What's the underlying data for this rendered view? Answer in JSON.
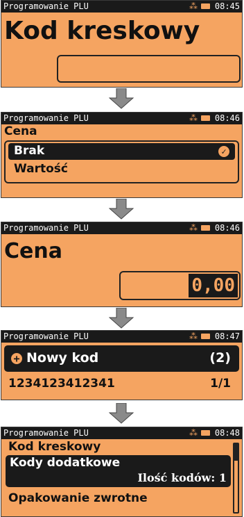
{
  "screen1": {
    "status_title": "Programowanie PLU",
    "time": "08:45",
    "heading": "Kod kreskowy",
    "input_value": ""
  },
  "screen2": {
    "status_title": "Programowanie PLU",
    "time": "08:46",
    "heading": "Cena",
    "options": [
      {
        "label": "Brak",
        "selected": true
      },
      {
        "label": "Wartość",
        "selected": false
      }
    ]
  },
  "screen3": {
    "status_title": "Programowanie PLU",
    "time": "08:46",
    "heading": "Cena",
    "input_value": "0,00"
  },
  "screen4": {
    "status_title": "Programowanie PLU",
    "time": "08:47",
    "new_code_label": "Nowy kod",
    "new_code_count": "(2)",
    "code_value": "1234123412341",
    "code_index": "1/1"
  },
  "screen5": {
    "status_title": "Programowanie PLU",
    "time": "08:48",
    "items": [
      {
        "label": "Kod kreskowy"
      },
      {
        "label": "Kody dodatkowe",
        "sub": "Ilość kodów: 1"
      },
      {
        "label": "Opakowanie zwrotne"
      }
    ]
  },
  "colors": {
    "screen_bg": "#f5a461",
    "bar": "#1a1a1a",
    "arrow": "#8a8a8a"
  }
}
